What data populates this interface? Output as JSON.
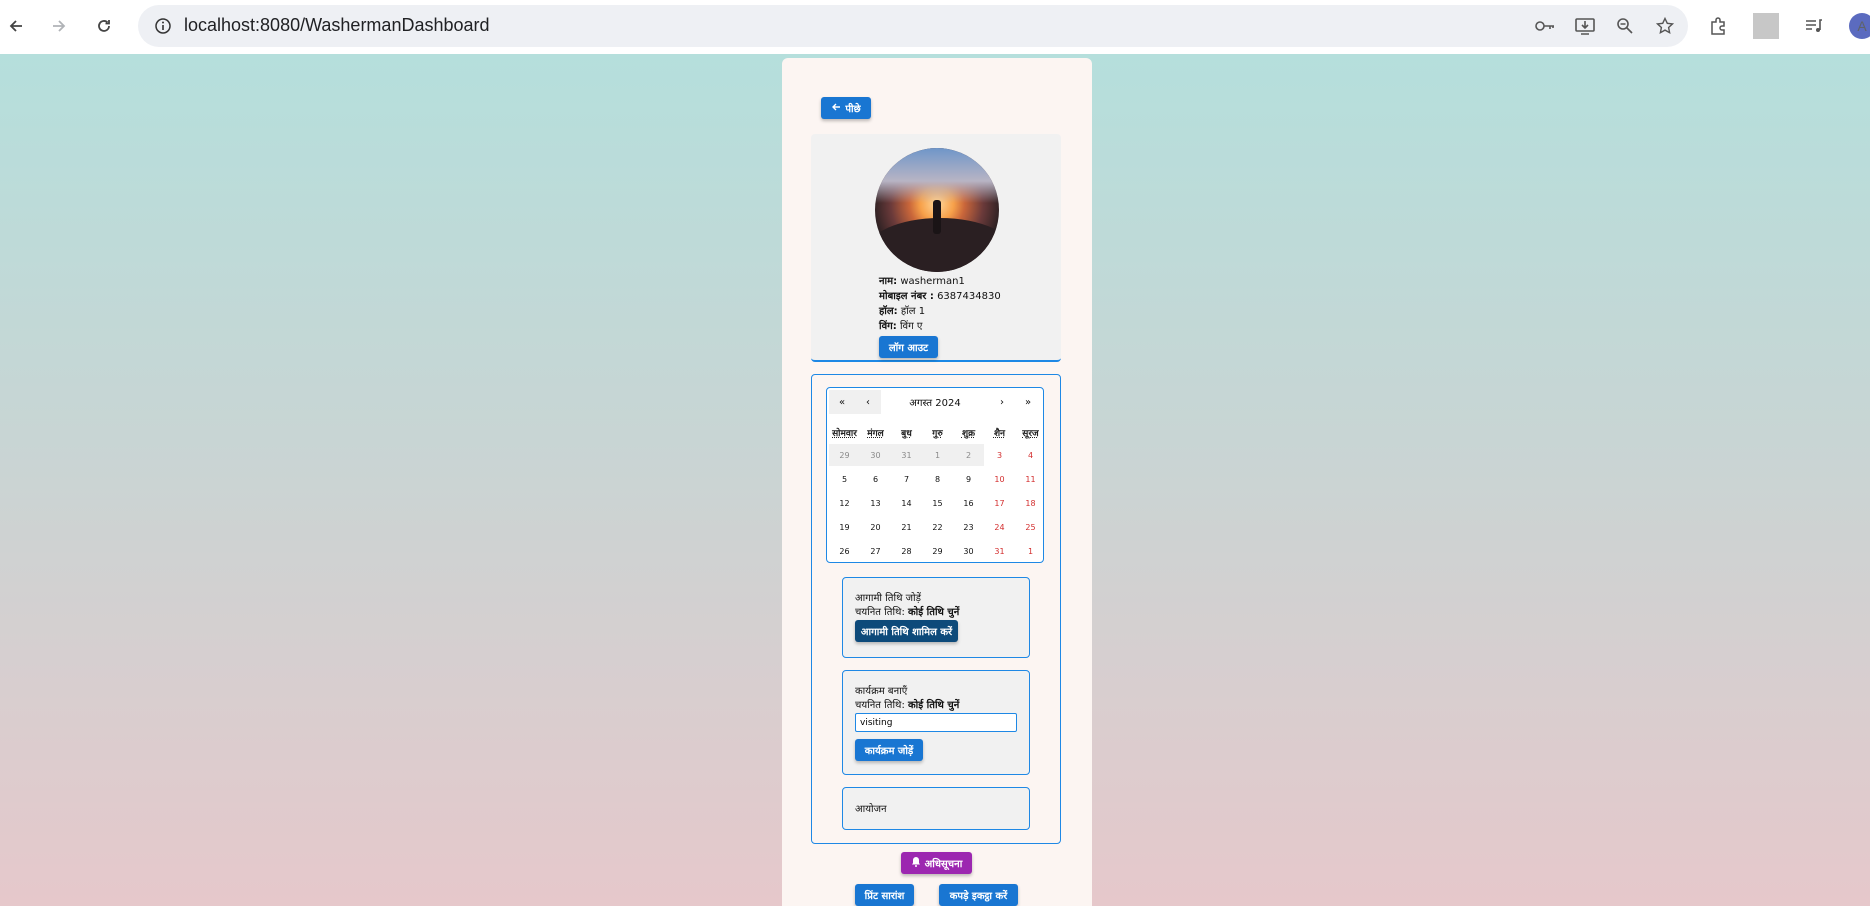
{
  "browser": {
    "url": "localhost:8080/WashermanDashboard",
    "profile_initial": "A"
  },
  "back": {
    "label": "पीछे"
  },
  "profile": {
    "name_label": "नाम:",
    "name": "washerman1",
    "mobile_label": "मोबाइल नंबर :",
    "mobile": "6387434830",
    "hall_label": "हॉल:",
    "hall": "हॉल 1",
    "wing_label": "विंग:",
    "wing": "विंग ए",
    "logout_label": "लॉग आउट"
  },
  "calendar": {
    "nav": {
      "first": "«",
      "prev": "‹",
      "title": "अगस्त 2024",
      "next": "›",
      "last": "»"
    },
    "weekdays": [
      "सोमवार",
      "मंगल",
      "बुध",
      "गुरु",
      "शुक्र",
      "शैन",
      "सूरज"
    ],
    "weeks": [
      [
        "29",
        "30",
        "31",
        "1",
        "2",
        "3",
        "4"
      ],
      [
        "5",
        "6",
        "7",
        "8",
        "9",
        "10",
        "11"
      ],
      [
        "12",
        "13",
        "14",
        "15",
        "16",
        "17",
        "18"
      ],
      [
        "19",
        "20",
        "21",
        "22",
        "23",
        "24",
        "25"
      ],
      [
        "26",
        "27",
        "28",
        "29",
        "30",
        "31",
        "1"
      ]
    ],
    "grey_days_first_row": 5
  },
  "upcoming": {
    "title": "आगामी तिथि जोड़ें",
    "selected_label": "चयनित तिथि:",
    "selected_value": "कोई तिथि चुनें",
    "button_label": "आगामी तिथि शामिल करें"
  },
  "event": {
    "title": "कार्यक्रम बनाएँ",
    "selected_label": "चयनित तिथि:",
    "selected_value": "कोई तिथि चुनें",
    "input_value": "visiting",
    "button_label": "कार्यक्रम जोड़ें"
  },
  "organize": {
    "title": "आयोजन"
  },
  "actions": {
    "notify_label": "अधिसूचना",
    "summary_label": "प्रिंट सारांश",
    "collect_label": "कपड़े इकट्ठा करें"
  },
  "colors": {
    "primary": "#1976d2",
    "notify": "#9c27b0",
    "weekend": "#d32f2f"
  }
}
